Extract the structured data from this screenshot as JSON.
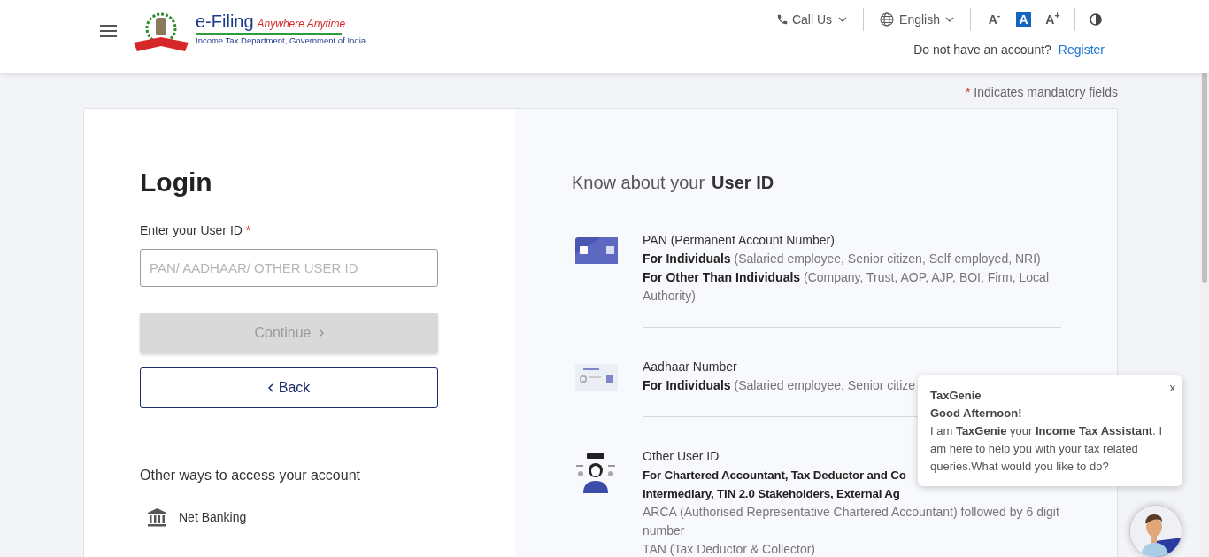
{
  "header": {
    "logo": {
      "title": "e-Filing",
      "tagline": "Anywhere Anytime",
      "subtitle": "Income Tax Department, Government of India"
    },
    "call_us": "Call Us",
    "language": "English",
    "font_controls": [
      {
        "label": "A$^{-}$",
        "selected": false
      },
      {
        "label": "A",
        "selected": true
      },
      {
        "label": "A$^{+}$",
        "selected": false
      }
    ],
    "account_prompt": "Do not have an account?",
    "register_link": "Register"
  },
  "mandatory_note": {
    "marker": "*",
    "text": "Indicates mandatory fields"
  },
  "login": {
    "title": "Login",
    "field": {
      "label": "Enter your User ID",
      "required_marker": "*",
      "placeholder": "PAN/ AADHAAR/ OTHER USER ID"
    },
    "continue_button": {
      "label": "Continue",
      "disabled": true
    },
    "back_button": "Back",
    "other_ways_heading": "Other ways to access your account",
    "other_ways": [
      {
        "label": "Net Banking"
      }
    ]
  },
  "user_id_info": {
    "heading_prefix": "Know about your",
    "heading_bold": "User ID",
    "items": [
      {
        "kind": "pan",
        "lines": [
          {
            "kind": "title",
            "text": "PAN (Permanent Account Number)"
          },
          {
            "kind": "detail",
            "text": "**For Individuals** (Salaried employee, Senior citizen, Self-employed, NRI)"
          },
          {
            "kind": "detail",
            "text": "**For Other Than Individuals** (Company, Trust, AOP, AJP, BOI, Firm, Local Authority)"
          }
        ]
      },
      {
        "kind": "aadhaar",
        "lines": [
          {
            "kind": "title",
            "text": "Aadhaar Number"
          },
          {
            "kind": "detail",
            "text": "**For Individuals** (Salaried employee, Senior citize"
          }
        ]
      },
      {
        "kind": "other",
        "lines": [
          {
            "kind": "title",
            "text": "Other User ID"
          },
          {
            "kind": "bold",
            "text": "For Chartered Accountant, Tax Deductor and Co"
          },
          {
            "kind": "bold",
            "text": "Intermediary, TIN 2.0 Stakeholders, External Ag"
          },
          {
            "kind": "note",
            "text": "ARCA (Authorised Representative Chartered Accountant) followed by 6 digit number"
          },
          {
            "kind": "note",
            "text": "TAN (Tax Deductor & Collector)"
          }
        ]
      }
    ]
  },
  "chat_popup": {
    "title": "TaxGenie",
    "greeting": "Good Afternoon!",
    "message": "I am **TaxGenie** your **Income Tax Assistant**. I am here to help you with your tax related queries.What would you like to do?",
    "close": "x"
  }
}
